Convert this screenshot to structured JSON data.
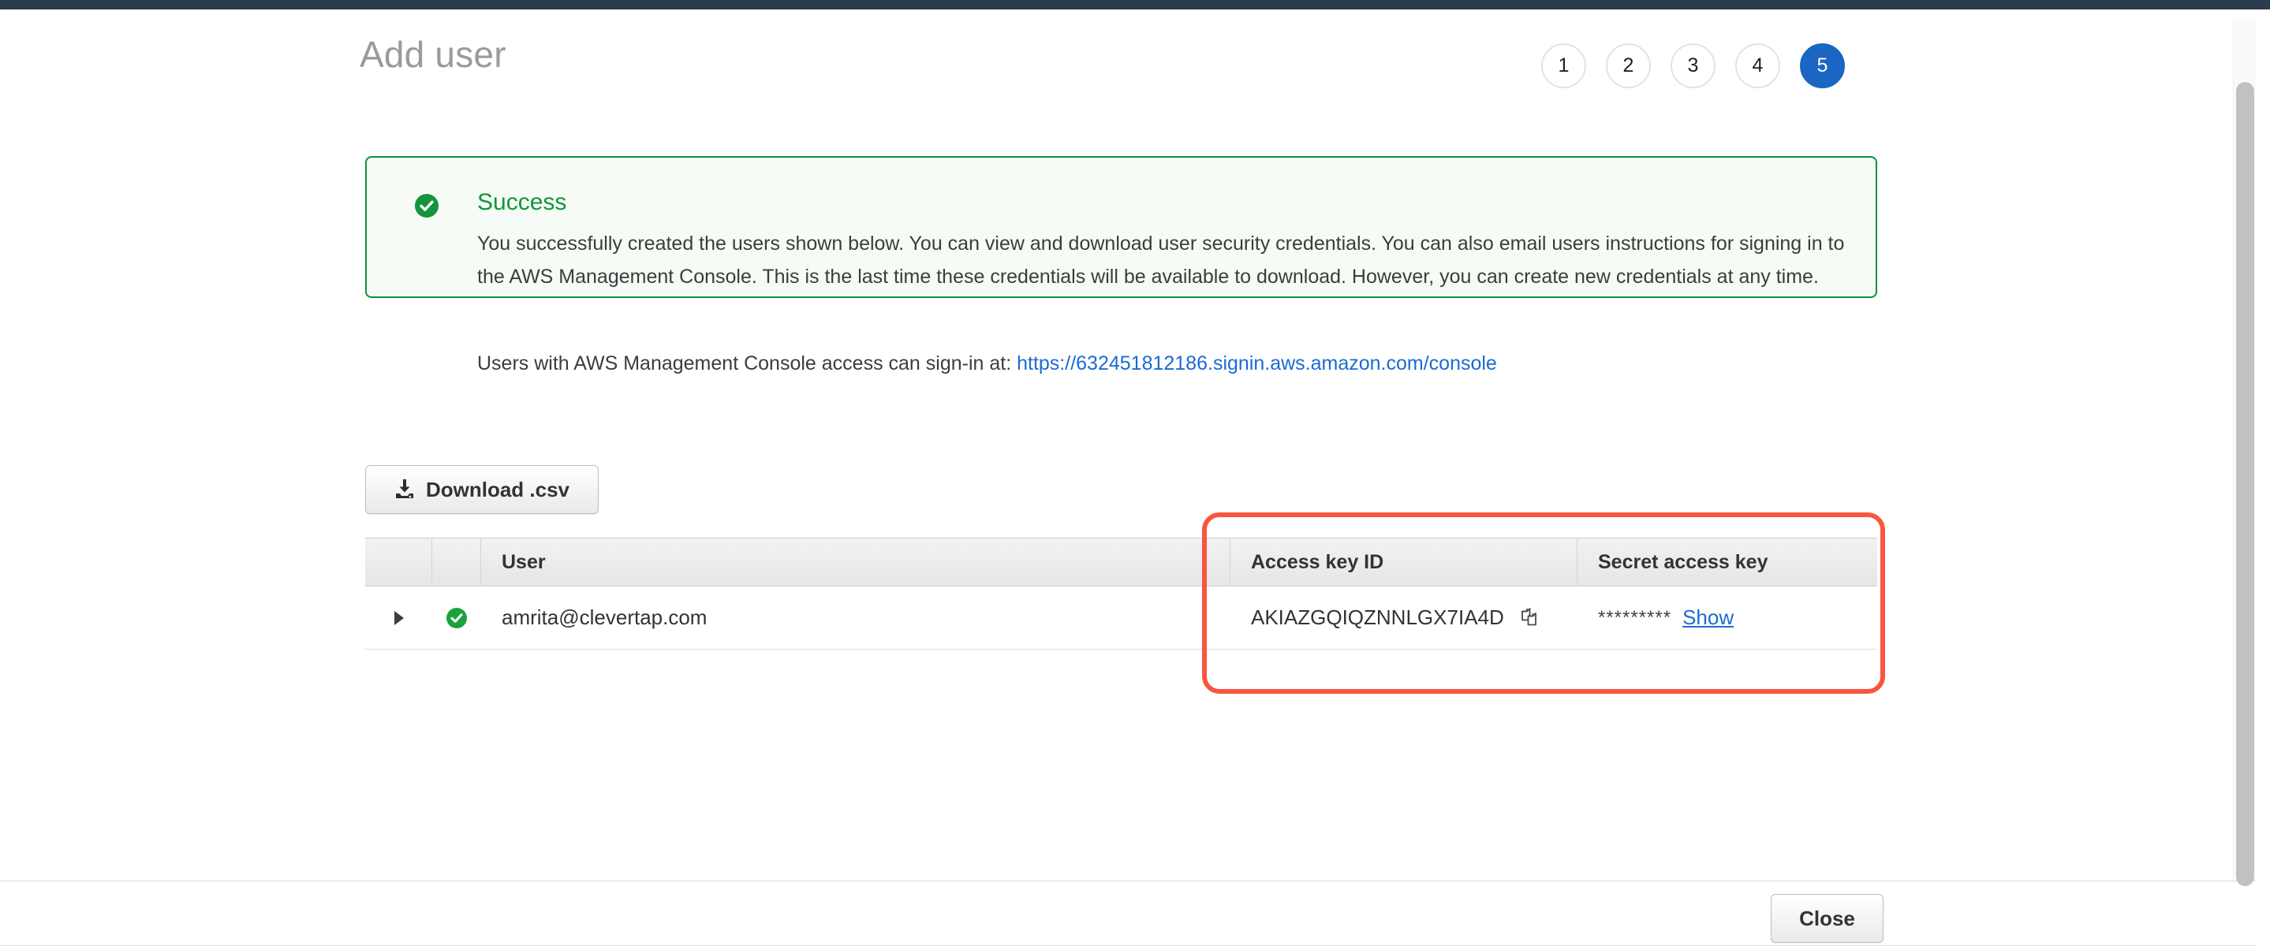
{
  "header": {
    "title": "Add user",
    "steps": [
      {
        "label": "1",
        "active": false
      },
      {
        "label": "2",
        "active": false
      },
      {
        "label": "3",
        "active": false
      },
      {
        "label": "4",
        "active": false
      },
      {
        "label": "5",
        "active": true
      }
    ]
  },
  "alert": {
    "icon": "success-check-icon",
    "title": "Success",
    "body": "You successfully created the users shown below. You can view and download user security credentials. You can also email users instructions for signing in to the AWS Management Console. This is the last time these credentials will be available to download. However, you can create new credentials at any time.",
    "signin_prefix": "Users with AWS Management Console access can sign-in at:",
    "signin_url": "https://632451812186.signin.aws.amazon.com/console",
    "border_color": "#0a9239",
    "background_color": "#f6fbf6",
    "title_color": "#12953b",
    "link_color": "#1a6bd4"
  },
  "toolbar": {
    "download_label": "Download .csv",
    "download_icon": "download-icon"
  },
  "table": {
    "columns": {
      "expand": "",
      "status": "",
      "user": "User",
      "access_key_id": "Access key ID",
      "secret_access_key": "Secret access key"
    },
    "rows": [
      {
        "expand_icon": "expand-arrow-icon",
        "status_icon": "success-check-icon",
        "user": "amrita@clevertap.com",
        "access_key_id": "AKIAZGQIQZNNLGX7IA4D",
        "copy_icon": "copy-icon",
        "secret_mask": "*********",
        "secret_action": "Show"
      }
    ]
  },
  "annotation": {
    "color": "#f9553f",
    "shape": "rounded-rectangle-highlight"
  },
  "footer": {
    "close_label": "Close"
  },
  "colors": {
    "top_bar": "#2a3b4d",
    "active_step": "#1a66c2",
    "link": "#1a6bd4",
    "success_green": "#12953b",
    "annotation_red": "#f9553f"
  }
}
